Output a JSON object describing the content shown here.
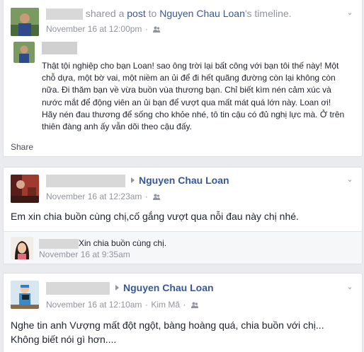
{
  "post1": {
    "author_redacted": "",
    "action_prefix": "shared a",
    "action_link": "post",
    "action_to": "to",
    "target_name": "Nguyen Chau Loan",
    "target_suffix": "'s timeline.",
    "timestamp": "November 16 at 12:00pm",
    "audience_icon": "friends-icon",
    "inner_author_redacted": "",
    "inner_text": "Thật tội nghiệp cho bạn Loan! sao ông trời lại bất công với bạn tôi thế này! Một chỗ dựa, một bờ vai, một niềm an ủi để đi hết quãng đường còn lại không còn nữa. Đi thăm bạn về vừa buồn vùa thương bạn. Chỉ biết kìm nén cảm xúc và nước mắt để động viên an ủi bạn để vượt qua mất mát quá lớn này. Loan ơi! Hãy nén đau thương để sống cho khỏe nhé, tô tin cậu có đủ nghị lực mà. Ở trên thiên đàng anh ấy vẫn dõi theo cậu đấy.",
    "share_label": "Share"
  },
  "post2": {
    "author_redacted": "",
    "target_name": "Nguyen Chau Loan",
    "timestamp": "November 16 at 12:23am",
    "audience_icon": "friends-icon",
    "text": "Em xin chia buồn cùng chị,cố gắng vượt qua nỗi đau này chị nhé.",
    "comment": {
      "author_redacted": "",
      "text": "Xin chia buồn cùng chị.",
      "timestamp": "November 16 at 9:35am"
    }
  },
  "post3": {
    "author_redacted": "",
    "target_name": "Nguyen Chau Loan",
    "timestamp": "November 16 at 12:10am",
    "location": "Kim Mã",
    "audience_icon": "friends-icon",
    "text_line1": "Nghe tin anh Vượng mất đột ngột, bàng hoàng quá, chia buồn với chị...",
    "text_line2": "Không biết nói gì hơn...."
  },
  "colors": {
    "link": "#365899",
    "meta": "#90949c",
    "background": "#e9ebee"
  }
}
